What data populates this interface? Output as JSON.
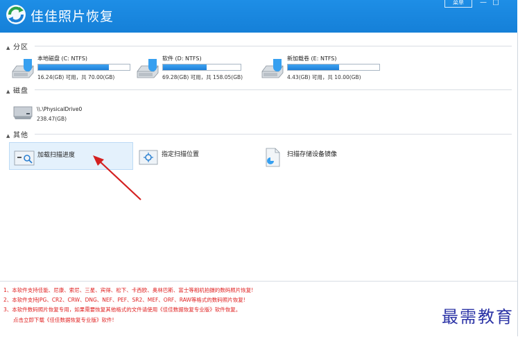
{
  "app": {
    "title": "佳佳照片恢复",
    "menu_label": "菜单"
  },
  "window_controls": {
    "minimize": "—",
    "maximize": "□"
  },
  "sections": {
    "partitions": "分区",
    "disks": "磁盘",
    "other": "其他"
  },
  "partitions": [
    {
      "name": "本地磁盘 (C: NTFS)",
      "info": "16.24(GB) 可用，共 70.00(GB)",
      "used_fraction": 0.77
    },
    {
      "name": "软件 (D: NTFS)",
      "info": "69.28(GB) 可用，共 158.05(GB)",
      "used_fraction": 0.56
    },
    {
      "name": "新加载卷 (E: NTFS)",
      "info": "4.43(GB) 可用，共 10.00(GB)",
      "used_fraction": 0.56
    }
  ],
  "disks": [
    {
      "name": "\\\\.\\PhysicalDrive0",
      "size": "238.47(GB)"
    }
  ],
  "tools": [
    {
      "label": "加载扫描进度",
      "icon": "load-scan-icon",
      "selected": true
    },
    {
      "label": "指定扫描位置",
      "icon": "scan-location-icon",
      "selected": false
    },
    {
      "label": "扫描存储设备镜像",
      "icon": "image-file-icon",
      "selected": false
    }
  ],
  "notes": [
    "1、本软件支持佳能、尼康、索尼、三星、宾得、松下、卡西欧、奥林巴斯、富士等相机拍摄的数码照片恢复!",
    "2、本软件支持JPG、CR2、CRW、DNG、NEF、PEF、SR2、MEF、ORF、RAW等格式的数码照片恢复!",
    "3、本软件数码照片恢复专用，如果需要恢复其他格式的文件请使用《佳佳数据恢复专业版》软件恢复。",
    "点击立即下载《佳佳数据恢复专业版》软件!"
  ],
  "watermark": "最需教育",
  "colors": {
    "titlebar": "#1580d8",
    "accent": "#1d7fd8",
    "note_text": "#e02020",
    "annotation_arrow": "#d42020"
  }
}
